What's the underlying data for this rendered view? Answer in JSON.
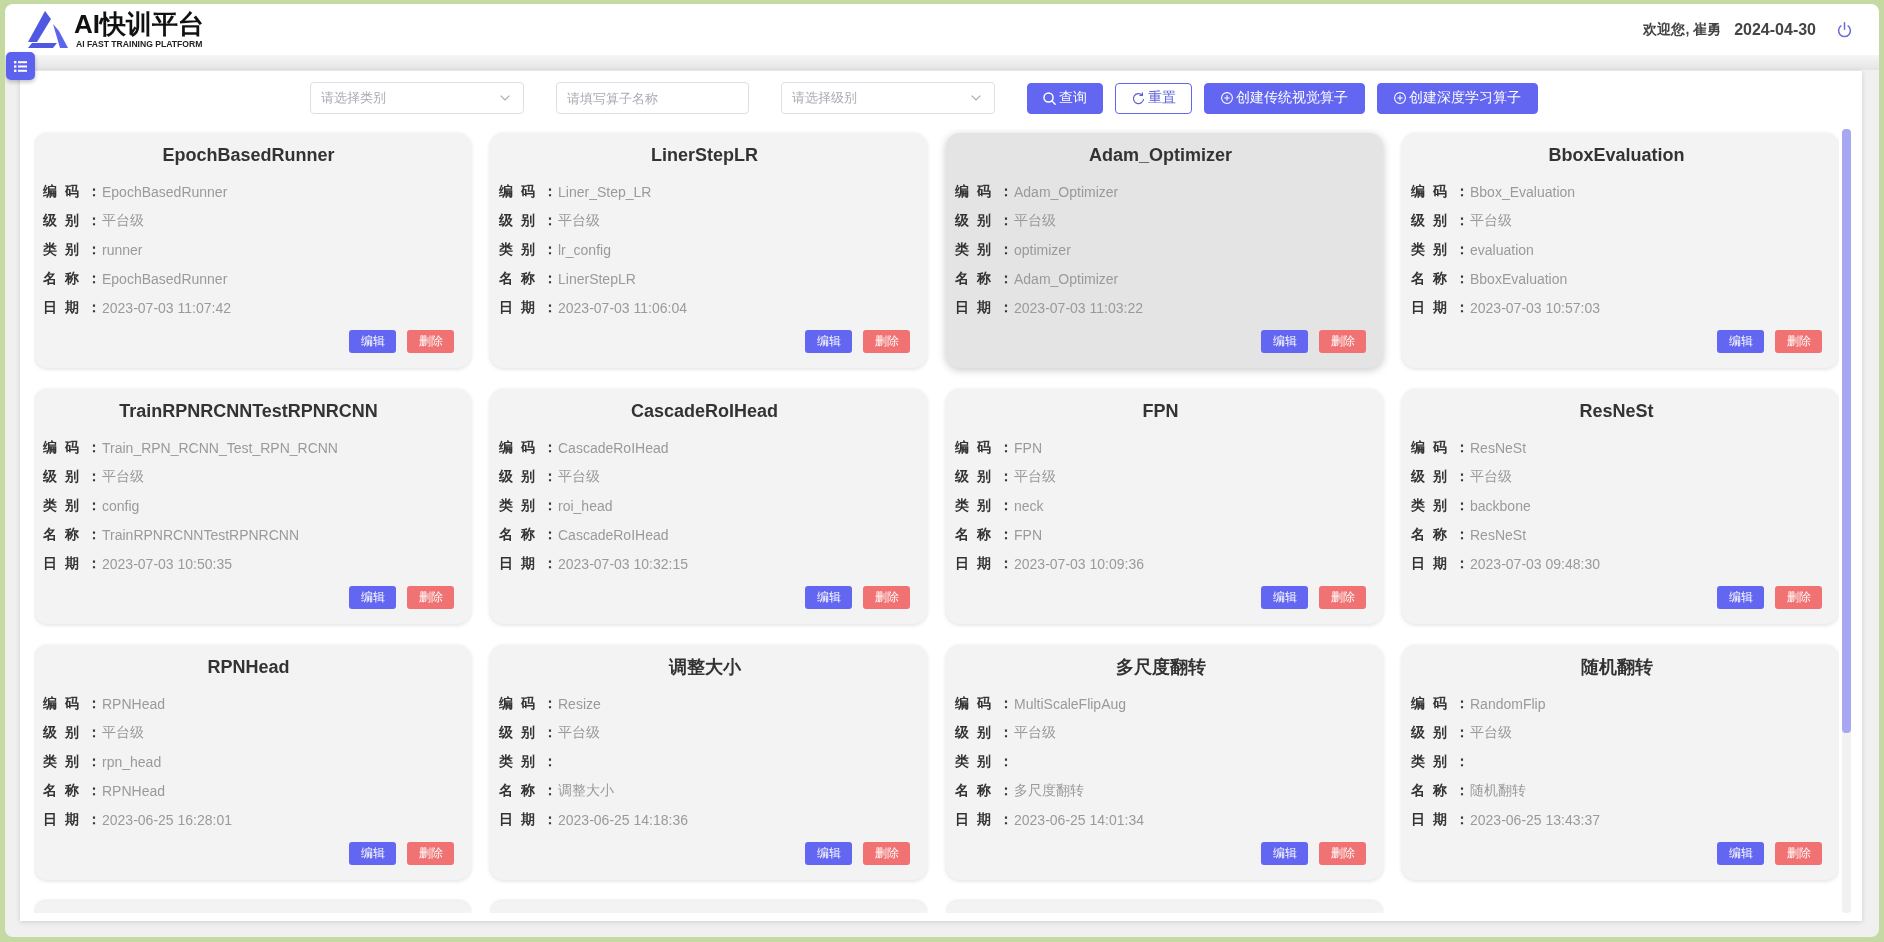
{
  "header": {
    "logo_title": "AI快训平台",
    "logo_subtitle": "AI FAST TRAINING PLATFORM",
    "welcome": "欢迎您, 崔勇",
    "date": "2024-04-30"
  },
  "toolbar": {
    "category_select": {
      "placeholder": "请选择类别"
    },
    "name_input": {
      "placeholder": "请填写算子名称"
    },
    "level_select": {
      "placeholder": "请选择级别"
    },
    "buttons": [
      {
        "kind": "search",
        "label": "查询"
      },
      {
        "kind": "reset",
        "label": "重置"
      },
      {
        "kind": "create",
        "label": "创建传统视觉算子"
      },
      {
        "kind": "create",
        "label": "创建深度学习算子"
      }
    ]
  },
  "cards": [
    {
      "kind": "full",
      "hovered": false,
      "title": "EpochBasedRunner",
      "fields": [
        {
          "label": "编 码 ：",
          "value": "EpochBasedRunner"
        },
        {
          "label": "级 别 ：",
          "value": "平台级"
        },
        {
          "label": "类 别 ：",
          "value": "runner"
        },
        {
          "label": "名 称 ：",
          "value": "EpochBasedRunner"
        },
        {
          "label": "日 期 ：",
          "value": "2023-07-03 11:07:42"
        }
      ],
      "buttons": [
        {
          "kind": "edit",
          "label": "编辑"
        },
        {
          "kind": "delete",
          "label": "删除"
        }
      ]
    },
    {
      "kind": "full",
      "hovered": false,
      "title": "LinerStepLR",
      "fields": [
        {
          "label": "编 码 ：",
          "value": "Liner_Step_LR"
        },
        {
          "label": "级 别 ：",
          "value": "平台级"
        },
        {
          "label": "类 别 ：",
          "value": "lr_config"
        },
        {
          "label": "名 称 ：",
          "value": "LinerStepLR"
        },
        {
          "label": "日 期 ：",
          "value": "2023-07-03 11:06:04"
        }
      ],
      "buttons": [
        {
          "kind": "edit",
          "label": "编辑"
        },
        {
          "kind": "delete",
          "label": "删除"
        }
      ]
    },
    {
      "kind": "full",
      "hovered": true,
      "title": "Adam_Optimizer",
      "fields": [
        {
          "label": "编 码 ：",
          "value": "Adam_Optimizer"
        },
        {
          "label": "级 别 ：",
          "value": "平台级"
        },
        {
          "label": "类 别 ：",
          "value": "optimizer"
        },
        {
          "label": "名 称 ：",
          "value": "Adam_Optimizer"
        },
        {
          "label": "日 期 ：",
          "value": "2023-07-03 11:03:22"
        }
      ],
      "buttons": [
        {
          "kind": "edit",
          "label": "编辑"
        },
        {
          "kind": "delete",
          "label": "删除"
        }
      ]
    },
    {
      "kind": "full",
      "hovered": false,
      "title": "BboxEvaluation",
      "fields": [
        {
          "label": "编 码 ：",
          "value": "Bbox_Evaluation"
        },
        {
          "label": "级 别 ：",
          "value": "平台级"
        },
        {
          "label": "类 别 ：",
          "value": "evaluation"
        },
        {
          "label": "名 称 ：",
          "value": "BboxEvaluation"
        },
        {
          "label": "日 期 ：",
          "value": "2023-07-03 10:57:03"
        }
      ],
      "buttons": [
        {
          "kind": "edit",
          "label": "编辑"
        },
        {
          "kind": "delete",
          "label": "删除"
        }
      ]
    },
    {
      "kind": "full",
      "hovered": false,
      "title": "TrainRPNRCNNTestRPNRCNN",
      "fields": [
        {
          "label": "编 码 ：",
          "value": "Train_RPN_RCNN_Test_RPN_RCNN"
        },
        {
          "label": "级 别 ：",
          "value": "平台级"
        },
        {
          "label": "类 别 ：",
          "value": "config"
        },
        {
          "label": "名 称 ：",
          "value": "TrainRPNRCNNTestRPNRCNN"
        },
        {
          "label": "日 期 ：",
          "value": "2023-07-03 10:50:35"
        }
      ],
      "buttons": [
        {
          "kind": "edit",
          "label": "编辑"
        },
        {
          "kind": "delete",
          "label": "删除"
        }
      ]
    },
    {
      "kind": "full",
      "hovered": false,
      "title": "CascadeRoIHead",
      "fields": [
        {
          "label": "编 码 ：",
          "value": "CascadeRoIHead"
        },
        {
          "label": "级 别 ：",
          "value": "平台级"
        },
        {
          "label": "类 别 ：",
          "value": "roi_head"
        },
        {
          "label": "名 称 ：",
          "value": "CascadeRoIHead"
        },
        {
          "label": "日 期 ：",
          "value": "2023-07-03 10:32:15"
        }
      ],
      "buttons": [
        {
          "kind": "edit",
          "label": "编辑"
        },
        {
          "kind": "delete",
          "label": "删除"
        }
      ]
    },
    {
      "kind": "full",
      "hovered": false,
      "title": "FPN",
      "fields": [
        {
          "label": "编 码 ：",
          "value": "FPN"
        },
        {
          "label": "级 别 ：",
          "value": "平台级"
        },
        {
          "label": "类 别 ：",
          "value": "neck"
        },
        {
          "label": "名 称 ：",
          "value": "FPN"
        },
        {
          "label": "日 期 ：",
          "value": "2023-07-03 10:09:36"
        }
      ],
      "buttons": [
        {
          "kind": "edit",
          "label": "编辑"
        },
        {
          "kind": "delete",
          "label": "删除"
        }
      ]
    },
    {
      "kind": "full",
      "hovered": false,
      "title": "ResNeSt",
      "fields": [
        {
          "label": "编 码 ：",
          "value": "ResNeSt"
        },
        {
          "label": "级 别 ：",
          "value": "平台级"
        },
        {
          "label": "类 别 ：",
          "value": "backbone"
        },
        {
          "label": "名 称 ：",
          "value": "ResNeSt"
        },
        {
          "label": "日 期 ：",
          "value": "2023-07-03 09:48:30"
        }
      ],
      "buttons": [
        {
          "kind": "edit",
          "label": "编辑"
        },
        {
          "kind": "delete",
          "label": "删除"
        }
      ]
    },
    {
      "kind": "full",
      "hovered": false,
      "title": "RPNHead",
      "fields": [
        {
          "label": "编 码 ：",
          "value": "RPNHead"
        },
        {
          "label": "级 别 ：",
          "value": "平台级"
        },
        {
          "label": "类 别 ：",
          "value": "rpn_head"
        },
        {
          "label": "名 称 ：",
          "value": "RPNHead"
        },
        {
          "label": "日 期 ：",
          "value": "2023-06-25 16:28:01"
        }
      ],
      "buttons": [
        {
          "kind": "edit",
          "label": "编辑"
        },
        {
          "kind": "delete",
          "label": "删除"
        }
      ]
    },
    {
      "kind": "full",
      "hovered": false,
      "title": "调整大小",
      "fields": [
        {
          "label": "编 码 ：",
          "value": "Resize"
        },
        {
          "label": "级 别 ：",
          "value": "平台级"
        },
        {
          "label": "类 别 ："
        },
        {
          "label": "名 称 ：",
          "value": "调整大小"
        },
        {
          "label": "日 期 ：",
          "value": "2023-06-25 14:18:36"
        }
      ],
      "buttons": [
        {
          "kind": "edit",
          "label": "编辑"
        },
        {
          "kind": "delete",
          "label": "删除"
        }
      ]
    },
    {
      "kind": "full",
      "hovered": false,
      "title": "多尺度翻转",
      "fields": [
        {
          "label": "编 码 ：",
          "value": "MultiScaleFlipAug"
        },
        {
          "label": "级 别 ：",
          "value": "平台级"
        },
        {
          "label": "类 别 ："
        },
        {
          "label": "名 称 ：",
          "value": "多尺度翻转"
        },
        {
          "label": "日 期 ：",
          "value": "2023-06-25 14:01:34"
        }
      ],
      "buttons": [
        {
          "kind": "edit",
          "label": "编辑"
        },
        {
          "kind": "delete",
          "label": "删除"
        }
      ]
    },
    {
      "kind": "full",
      "hovered": false,
      "title": "随机翻转",
      "fields": [
        {
          "label": "编 码 ：",
          "value": "RandomFlip"
        },
        {
          "label": "级 别 ：",
          "value": "平台级"
        },
        {
          "label": "类 别 ："
        },
        {
          "label": "名 称 ：",
          "value": "随机翻转"
        },
        {
          "label": "日 期 ：",
          "value": "2023-06-25 13:43:37"
        }
      ],
      "buttons": [
        {
          "kind": "edit",
          "label": "编辑"
        },
        {
          "kind": "delete",
          "label": "删除"
        }
      ]
    },
    {
      "kind": "cut_off",
      "hovered": false
    },
    {
      "kind": "cut_off",
      "hovered": false
    },
    {
      "kind": "cut_off",
      "hovered": false
    }
  ]
}
